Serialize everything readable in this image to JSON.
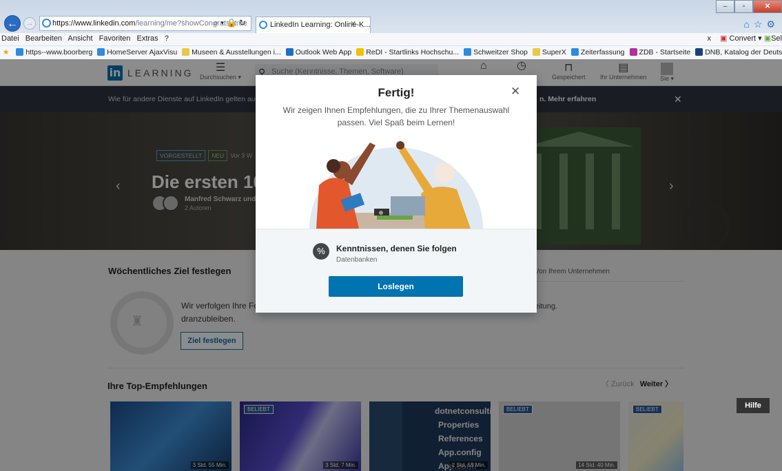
{
  "browser": {
    "url_host": "https://www.linkedin.com",
    "url_path": "/learning/me?showCongrats=true",
    "tab_title": "LinkedIn Learning: Online-K...",
    "menu": [
      "Datei",
      "Bearbeiten",
      "Ansicht",
      "Favoriten",
      "Extras",
      "?"
    ],
    "menu_right": "Convert",
    "menu_right2": "Sel",
    "favorites": [
      {
        "label": "https--www.boorberg",
        "color": "#2a8be0"
      },
      {
        "label": "HomeServer AjaxVisu",
        "color": "#2a8be0"
      },
      {
        "label": "Museen & Ausstellungen i...",
        "color": "#e8c84a"
      },
      {
        "label": "Outlook Web App",
        "color": "#1d6fc4"
      },
      {
        "label": "ReDI - Startlinks Hochschu...",
        "color": "#f2c200"
      },
      {
        "label": "Schweitzer Shop",
        "color": "#2a8be0"
      },
      {
        "label": "SuperX",
        "color": "#e8c84a"
      },
      {
        "label": "Zeiterfassung",
        "color": "#2a8be0"
      },
      {
        "label": "ZDB - Startseite",
        "color": "#b0309c"
      },
      {
        "label": "DNB, Katalog der Deutsch...",
        "color": "#1b3f7a"
      },
      {
        "label": "EBM-Tool",
        "color": "#888888"
      }
    ]
  },
  "linkedin": {
    "logo_mark": "in",
    "logo_word": "LEARNING",
    "nav_browse": "Durchsuchen ▾",
    "search_placeholder": "Suche (Kenntnisse, Themen, Software)",
    "nav_saved": "Gespeichert",
    "nav_company": "Ihr Unternehmen",
    "nav_me": "Sie ▾",
    "notice_text": "Wie für andere Dienste auf LinkedIn gelten auc",
    "notice_more": "n. Mehr erfahren",
    "hero": {
      "badge_featured": "VORGESTELLT",
      "badge_new": "NEU",
      "age": "Vor 3 W",
      "title": "Die ersten 100",
      "author": "Manfred Schwarz und",
      "authors_count": "2 Autoren"
    },
    "goal": {
      "title": "Wöchentliches Ziel festlegen",
      "text": "Wir verfolgen Ihre Fo dranzubleiben.",
      "button": "Ziel festlegen",
      "org_tab": "Von Ihrem Unternehmen",
      "org_text": "eitung."
    },
    "recs": {
      "title": "Ihre Top-Empfehlungen",
      "prev": "〈 Zurück",
      "next": "Weiter 〉",
      "cards": [
        {
          "badge": "",
          "duration": "3 Std. 55 Min."
        },
        {
          "badge": "BELIEBT",
          "duration": "3 Std. 7 Min."
        },
        {
          "badge": "",
          "duration": "2 Std. 55 Min.",
          "code": [
            "dotnetconsulti",
            "Properties",
            "References",
            "App.config",
            "App.confi"
          ]
        },
        {
          "badge": "BELIEBT",
          "duration": "14 Std. 40 Min."
        },
        {
          "badge": "BELIEBT",
          "duration": ""
        }
      ]
    },
    "help": "Hilfe"
  },
  "modal": {
    "title": "Fertig!",
    "subtitle": "Wir zeigen Ihnen Empfehlungen, die zu Ihrer Themenauswahl passen. Viel Spaß beim Lernen!",
    "skill_title": "Kenntnissen, denen Sie folgen",
    "skill_sub": "Datenbanken",
    "button": "Loslegen",
    "close": "✕"
  }
}
